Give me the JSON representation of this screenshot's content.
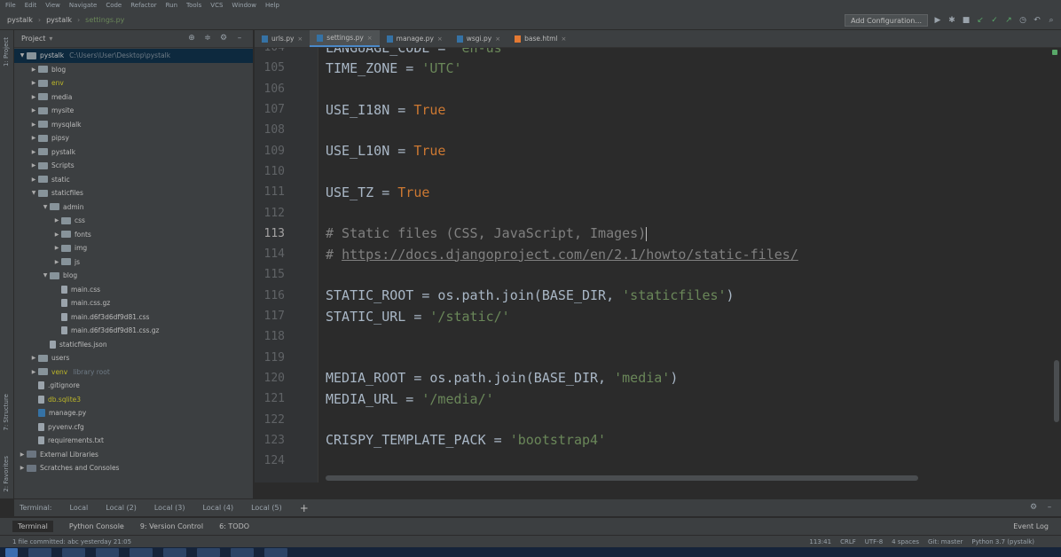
{
  "menu": [
    "File",
    "Edit",
    "View",
    "Navigate",
    "Code",
    "Refactor",
    "Run",
    "Tools",
    "VCS",
    "Window",
    "Help"
  ],
  "breadcrumb": {
    "project": "pystalk",
    "folder": "pystalk",
    "file": "settings.py"
  },
  "toolbar": {
    "run_config": "Add Configuration..."
  },
  "project_panel": {
    "title": "Project",
    "tree": [
      {
        "label": "pystalk",
        "path": "C:\\Users\\User\\Desktop\\pystalk",
        "depth": 0,
        "expanded": true,
        "selected": true,
        "type": "folder"
      },
      {
        "label": "blog",
        "depth": 1,
        "expanded": false,
        "type": "folder"
      },
      {
        "label": "env",
        "depth": 1,
        "expanded": false,
        "type": "folder",
        "highlight": true
      },
      {
        "label": "media",
        "depth": 1,
        "expanded": false,
        "type": "folder"
      },
      {
        "label": "mysite",
        "depth": 1,
        "expanded": false,
        "type": "folder"
      },
      {
        "label": "mysqlalk",
        "depth": 1,
        "expanded": false,
        "type": "folder"
      },
      {
        "label": "pipsy",
        "depth": 1,
        "expanded": false,
        "type": "folder"
      },
      {
        "label": "pystalk",
        "depth": 1,
        "expanded": false,
        "type": "folder"
      },
      {
        "label": "Scripts",
        "depth": 1,
        "expanded": false,
        "type": "folder"
      },
      {
        "label": "static",
        "depth": 1,
        "expanded": false,
        "type": "folder"
      },
      {
        "label": "staticfiles",
        "depth": 1,
        "expanded": true,
        "type": "folder"
      },
      {
        "label": "admin",
        "depth": 2,
        "expanded": true,
        "type": "folder"
      },
      {
        "label": "css",
        "depth": 3,
        "expanded": false,
        "type": "folder"
      },
      {
        "label": "fonts",
        "depth": 3,
        "expanded": false,
        "type": "folder"
      },
      {
        "label": "img",
        "depth": 3,
        "expanded": false,
        "type": "folder"
      },
      {
        "label": "js",
        "depth": 3,
        "expanded": false,
        "type": "folder"
      },
      {
        "label": "blog",
        "depth": 2,
        "expanded": true,
        "type": "folder"
      },
      {
        "label": "main.css",
        "depth": 3,
        "type": "file"
      },
      {
        "label": "main.css.gz",
        "depth": 3,
        "type": "file"
      },
      {
        "label": "main.d6f3d6df9d81.css",
        "depth": 3,
        "type": "file"
      },
      {
        "label": "main.d6f3d6df9d81.css.gz",
        "depth": 3,
        "type": "file"
      },
      {
        "label": "staticfiles.json",
        "depth": 2,
        "type": "file"
      },
      {
        "label": "users",
        "depth": 1,
        "expanded": false,
        "type": "folder"
      },
      {
        "label": "venv",
        "path": "library root",
        "depth": 1,
        "expanded": false,
        "type": "folder",
        "highlight": true
      },
      {
        "label": ".gitignore",
        "depth": 1,
        "type": "file"
      },
      {
        "label": "db.sqlite3",
        "depth": 1,
        "type": "file",
        "highlight": true
      },
      {
        "label": "manage.py",
        "depth": 1,
        "type": "py"
      },
      {
        "label": "pyvenv.cfg",
        "depth": 1,
        "type": "file"
      },
      {
        "label": "requirements.txt",
        "depth": 1,
        "type": "file"
      },
      {
        "label": "External Libraries",
        "depth": 0,
        "expanded": false,
        "type": "lib"
      },
      {
        "label": "Scratches and Consoles",
        "depth": 0,
        "expanded": false,
        "type": "lib"
      }
    ]
  },
  "tabs": [
    {
      "label": "urls.py",
      "active": false,
      "icon": "py"
    },
    {
      "label": "settings.py",
      "active": true,
      "icon": "py"
    },
    {
      "label": "manage.py",
      "active": false,
      "icon": "py"
    },
    {
      "label": "wsgi.py",
      "active": false,
      "icon": "py"
    },
    {
      "label": "base.html",
      "active": false,
      "icon": "html"
    }
  ],
  "editor": {
    "current_line": "113",
    "lines": [
      {
        "n": "104",
        "segments": [
          {
            "t": "LANGUAGE_CODE = ",
            "c": "plain"
          },
          {
            "t": "'en-us'",
            "c": "str"
          }
        ]
      },
      {
        "n": "105",
        "segments": [
          {
            "t": "TIME_ZONE = ",
            "c": "plain"
          },
          {
            "t": "'UTC'",
            "c": "str"
          }
        ]
      },
      {
        "n": "106",
        "segments": []
      },
      {
        "n": "107",
        "segments": [
          {
            "t": "USE_I18N = ",
            "c": "plain"
          },
          {
            "t": "True",
            "c": "kw"
          }
        ]
      },
      {
        "n": "108",
        "segments": []
      },
      {
        "n": "109",
        "segments": [
          {
            "t": "USE_L10N = ",
            "c": "plain"
          },
          {
            "t": "True",
            "c": "kw"
          }
        ]
      },
      {
        "n": "110",
        "segments": []
      },
      {
        "n": "111",
        "segments": [
          {
            "t": "USE_TZ = ",
            "c": "plain"
          },
          {
            "t": "True",
            "c": "kw"
          }
        ]
      },
      {
        "n": "112",
        "segments": []
      },
      {
        "n": "113",
        "segments": [
          {
            "t": "# Static files (CSS, JavaScript, Images)",
            "c": "cmt"
          }
        ],
        "caret": true
      },
      {
        "n": "114",
        "segments": [
          {
            "t": "# ",
            "c": "cmt"
          },
          {
            "t": "https://docs.djangoproject.com/en/2.1/howto/static-files/",
            "c": "link"
          }
        ]
      },
      {
        "n": "115",
        "segments": []
      },
      {
        "n": "116",
        "segments": [
          {
            "t": "STATIC_ROOT = os.path.join(BASE_DIR, ",
            "c": "plain"
          },
          {
            "t": "'staticfiles'",
            "c": "str"
          },
          {
            "t": ")",
            "c": "plain"
          }
        ]
      },
      {
        "n": "117",
        "segments": [
          {
            "t": "STATIC_URL = ",
            "c": "plain"
          },
          {
            "t": "'/static/'",
            "c": "str"
          }
        ]
      },
      {
        "n": "118",
        "segments": []
      },
      {
        "n": "119",
        "segments": []
      },
      {
        "n": "120",
        "segments": [
          {
            "t": "MEDIA_ROOT = os.path.join(BASE_DIR, ",
            "c": "plain"
          },
          {
            "t": "'media'",
            "c": "str"
          },
          {
            "t": ")",
            "c": "plain"
          }
        ]
      },
      {
        "n": "121",
        "segments": [
          {
            "t": "MEDIA_URL = ",
            "c": "plain"
          },
          {
            "t": "'/media/'",
            "c": "str"
          }
        ]
      },
      {
        "n": "122",
        "segments": []
      },
      {
        "n": "123",
        "segments": [
          {
            "t": "CRISPY_TEMPLATE_PACK = ",
            "c": "plain"
          },
          {
            "t": "'bootstrap4'",
            "c": "str"
          }
        ]
      },
      {
        "n": "124",
        "segments": []
      }
    ]
  },
  "terminal_tabs": [
    "Terminal:",
    "Local",
    "Local (2)",
    "Local (3)",
    "Local (4)",
    "Local (5)"
  ],
  "bottom_tools": [
    {
      "label": "Terminal",
      "active": true
    },
    {
      "label": "Python Console",
      "active": false
    },
    {
      "label": "9: Version Control",
      "active": false
    },
    {
      "label": "6: TODO",
      "active": false
    }
  ],
  "event_log": "Event Log",
  "status": {
    "message": "1 file committed: abc yesterday 21:05",
    "right": [
      "113:41",
      "CRLF",
      "UTF-8",
      "4 spaces",
      "Git: master",
      "Python 3.7 (pystalk)"
    ]
  },
  "colors": {
    "accent": "#4a88c7",
    "string": "#6a8759",
    "keyword": "#cc7832",
    "comment": "#808080"
  }
}
